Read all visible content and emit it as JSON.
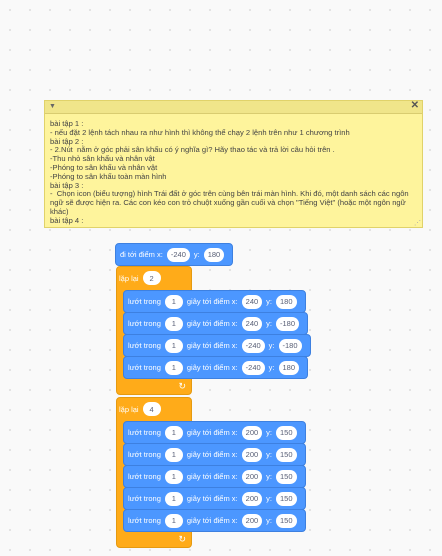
{
  "comment": {
    "lines": [
      "bài tập 1 :",
      "- nếu đặt 2 lệnh tách nhau ra như hình thì không thể chạy 2 lệnh trên như 1 chương trình",
      "bài tập 2 :",
      "- 2.Nút  nằm ở góc phải sân khấu có ý nghĩa gì? Hãy thao tác và trả lời câu hỏi trên .",
      "-Thu nhỏ sân khấu và nhân vật",
      "-Phóng to sân khấu và nhân vật",
      "-Phóng to sân khấu toàn màn hình",
      "bài tập 3 :",
      "-  Chọn icon (biểu tượng) hình Trái đất ở góc trên cùng bên trái màn hình. Khi đó, một danh sách các ngôn ngữ sẽ được hiện ra. Các con kéo con trỏ chuột xuống gần cuối và chọn \"Tiếng Việt\" (hoặc một ngôn ngữ khác)",
      "bài tập 4 :"
    ]
  },
  "goto": {
    "label": "đi tới điểm x:",
    "x": "-240",
    "ylabel": "y:",
    "y": "180"
  },
  "loops": [
    {
      "label": "lặp lại",
      "count": "2",
      "blocks": [
        {
          "a": "lướt trong",
          "t": "1",
          "b": "giây tới điểm x:",
          "x": "240",
          "c": "y:",
          "y": "180"
        },
        {
          "a": "lướt trong",
          "t": "1",
          "b": "giây tới điểm x:",
          "x": "240",
          "c": "y:",
          "y": "-180"
        },
        {
          "a": "lướt trong",
          "t": "1",
          "b": "giây tới điểm x:",
          "x": "-240",
          "c": "y:",
          "y": "-180"
        },
        {
          "a": "lướt trong",
          "t": "1",
          "b": "giây tới điểm x:",
          "x": "-240",
          "c": "y:",
          "y": "180"
        }
      ]
    },
    {
      "label": "lặp lại",
      "count": "4",
      "blocks": [
        {
          "a": "lướt trong",
          "t": "1",
          "b": "giây tới điểm x:",
          "x": "200",
          "c": "y:",
          "y": "150"
        },
        {
          "a": "lướt trong",
          "t": "1",
          "b": "giây tới điểm x:",
          "x": "200",
          "c": "y:",
          "y": "150"
        },
        {
          "a": "lướt trong",
          "t": "1",
          "b": "giây tới điểm x:",
          "x": "200",
          "c": "y:",
          "y": "150"
        },
        {
          "a": "lướt trong",
          "t": "1",
          "b": "giây tới điểm x:",
          "x": "200",
          "c": "y:",
          "y": "150"
        },
        {
          "a": "lướt trong",
          "t": "1",
          "b": "giây tới điểm x:",
          "x": "200",
          "c": "y:",
          "y": "150"
        }
      ]
    }
  ]
}
